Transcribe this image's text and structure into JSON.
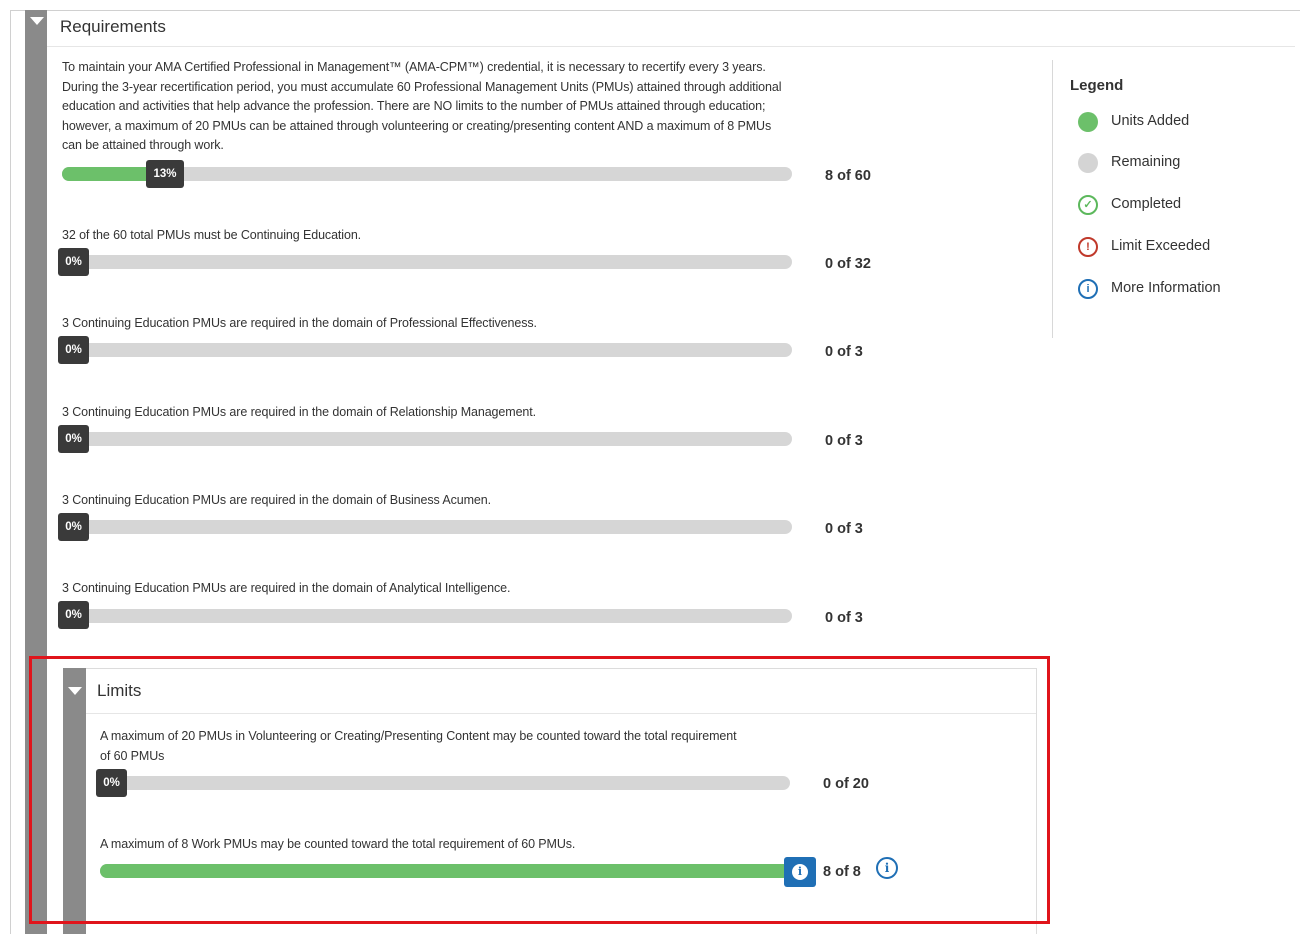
{
  "requirements": {
    "title": "Requirements",
    "intro": "To maintain your AMA Certified Professional in Management™ (AMA-CPM™) credential, it is necessary to recertify every 3 years. During the 3-year recertification period, you must accumulate 60 Professional Management Units (PMUs) attained through additional education and activities that help advance the profession. There are NO limits to the number of PMUs attained through education; however, a maximum of 20 PMUs can be attained through volunteering or creating/presenting content AND a maximum of 8 PMUs can be attained through work.",
    "items": [
      {
        "description": "",
        "percent_label": "13%",
        "progress": 0.13,
        "count": "8 of 60"
      },
      {
        "description": "32 of the 60 total PMUs must be Continuing Education.",
        "percent_label": "0%",
        "progress": 0,
        "count": "0 of 32"
      },
      {
        "description": "3 Continuing Education PMUs are required in the domain of Professional Effectiveness.",
        "percent_label": "0%",
        "progress": 0,
        "count": "0 of 3"
      },
      {
        "description": "3 Continuing Education PMUs are required in the domain of Relationship Management.",
        "percent_label": "0%",
        "progress": 0,
        "count": "0 of 3"
      },
      {
        "description": "3 Continuing Education PMUs are required in the domain of Business Acumen.",
        "percent_label": "0%",
        "progress": 0,
        "count": "0 of 3"
      },
      {
        "description": "3 Continuing Education PMUs are required in the domain of Analytical Intelligence.",
        "percent_label": "0%",
        "progress": 0,
        "count": "0 of 3"
      }
    ]
  },
  "legend": {
    "title": "Legend",
    "items": [
      {
        "label": "Units Added",
        "icon": "green-dot-icon"
      },
      {
        "label": "Remaining",
        "icon": "gray-dot-icon"
      },
      {
        "label": "Completed",
        "icon": "check-circle-icon"
      },
      {
        "label": "Limit Exceeded",
        "icon": "exclamation-circle-icon"
      },
      {
        "label": "More Information",
        "icon": "info-circle-icon"
      }
    ]
  },
  "limits": {
    "title": "Limits",
    "items": [
      {
        "description": "A maximum of 20 PMUs in Volunteering or Creating/Presenting Content may be counted toward the total requirement of 60 PMUs",
        "percent_label": "0%",
        "progress": 0,
        "count": "0 of 20"
      },
      {
        "description": "A maximum of 8 Work PMUs may be counted toward the total requirement of 60 PMUs.",
        "progress": 1,
        "count": "8 of 8"
      }
    ]
  },
  "colors": {
    "units_added": "#6cc06a",
    "remaining": "#d6d6d6",
    "completed": "#5cb85c",
    "limit_exceeded": "#c0392b",
    "more_information": "#1f6fb5",
    "highlight": "#e0141b"
  }
}
